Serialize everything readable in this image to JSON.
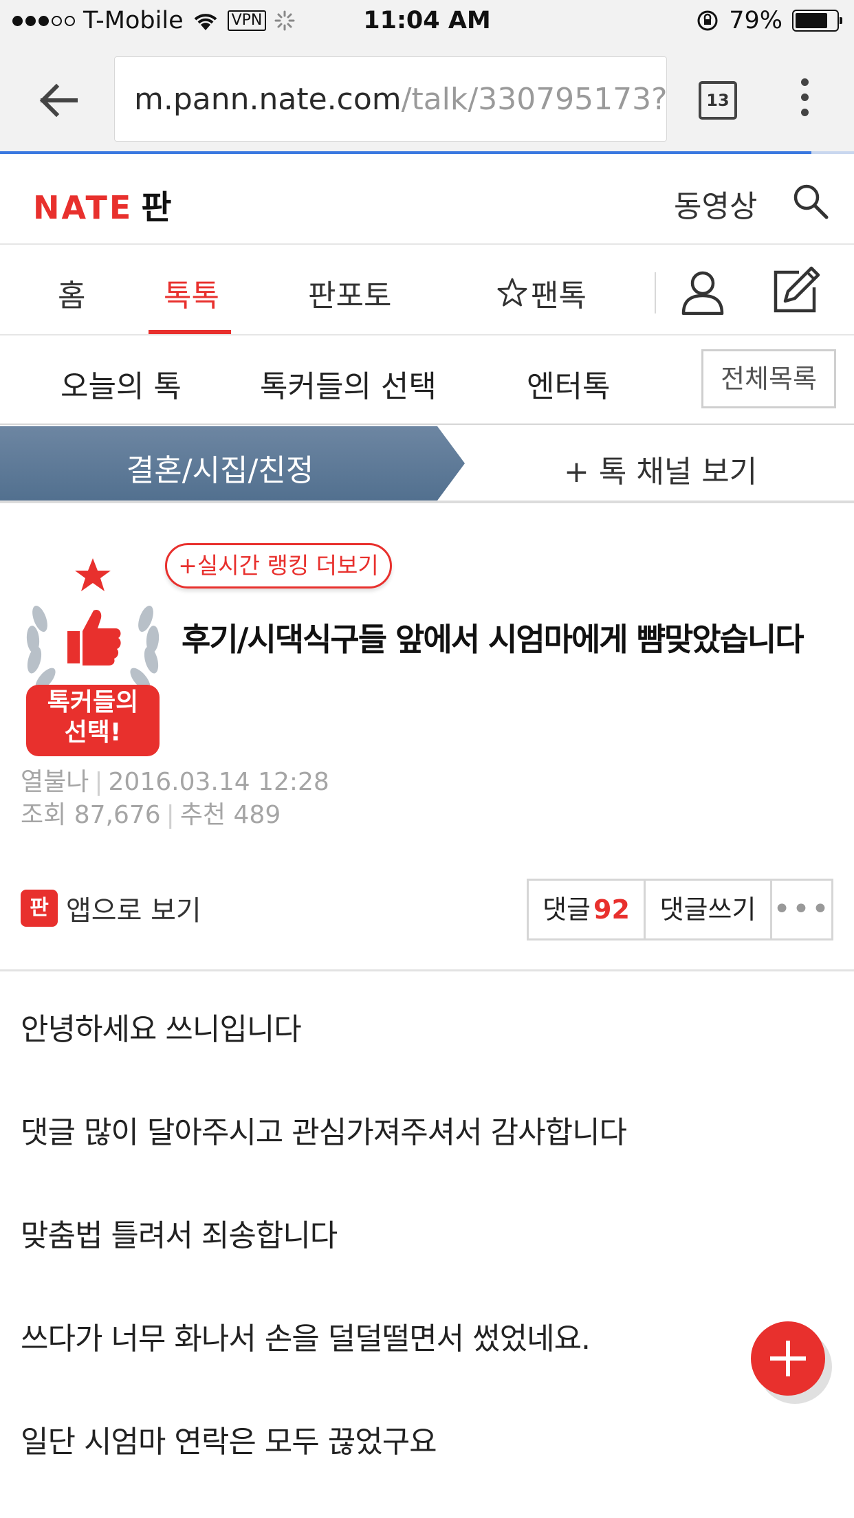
{
  "status_bar": {
    "carrier": "T-Mobile",
    "vpn": "VPN",
    "time": "11:04 AM",
    "battery_percent": "79%",
    "battery_level": 0.79,
    "signal_bars_filled": 3,
    "signal_bars_total": 5
  },
  "browser": {
    "url_host": "m.pann.nate.com",
    "url_path": "/talk/330795173?",
    "tab_count": "13",
    "load_progress": 0.95
  },
  "header": {
    "logo_text": "NATE",
    "logo_sub": "판",
    "video_label": "동영상"
  },
  "main_nav": {
    "items": [
      {
        "label": "홈"
      },
      {
        "label": "톡톡"
      },
      {
        "label": "판포토"
      },
      {
        "label": "팬톡"
      }
    ],
    "active": "톡톡"
  },
  "sub_nav": {
    "items": [
      {
        "label": "오늘의 톡"
      },
      {
        "label": "톡커들의 선택"
      },
      {
        "label": "엔터톡"
      }
    ],
    "all_list_label": "전체목록"
  },
  "category": {
    "current": "결혼/시집/친정",
    "channel_link": "+ 톡 채널 보기"
  },
  "post": {
    "badge_text_line1": "톡커들의",
    "badge_text_line2": "선택!",
    "ranking_button": "+실시간 랭킹 더보기",
    "title": "후기/시댁식구들 앞에서 시엄마에게 뺨맞았습니다",
    "author": "열불나",
    "date": "2016.03.14 12:28",
    "views_label": "조회",
    "views": "87,676",
    "recommend_label": "추천",
    "recommend": "489"
  },
  "actions": {
    "app_icon_text": "판",
    "app_view_label": "앱으로 보기",
    "comment_label": "댓글",
    "comment_count": "92",
    "write_comment_label": "댓글쓰기",
    "more_label": "•••"
  },
  "body": {
    "paragraphs": [
      "안녕하세요 쓰니입니다",
      "댓글 많이 달아주시고 관심가져주셔서 감사합니다",
      "맞춤법 틀려서 죄송합니다",
      "쓰다가 너무 화나서 손을 덜덜떨면서 썼었네요.",
      "일단 시엄마 연락은 모두 끊었구요"
    ]
  },
  "colors": {
    "brand_red": "#e8302d",
    "category_bg": "#5b7592",
    "progress_blue": "#3a78e0"
  }
}
